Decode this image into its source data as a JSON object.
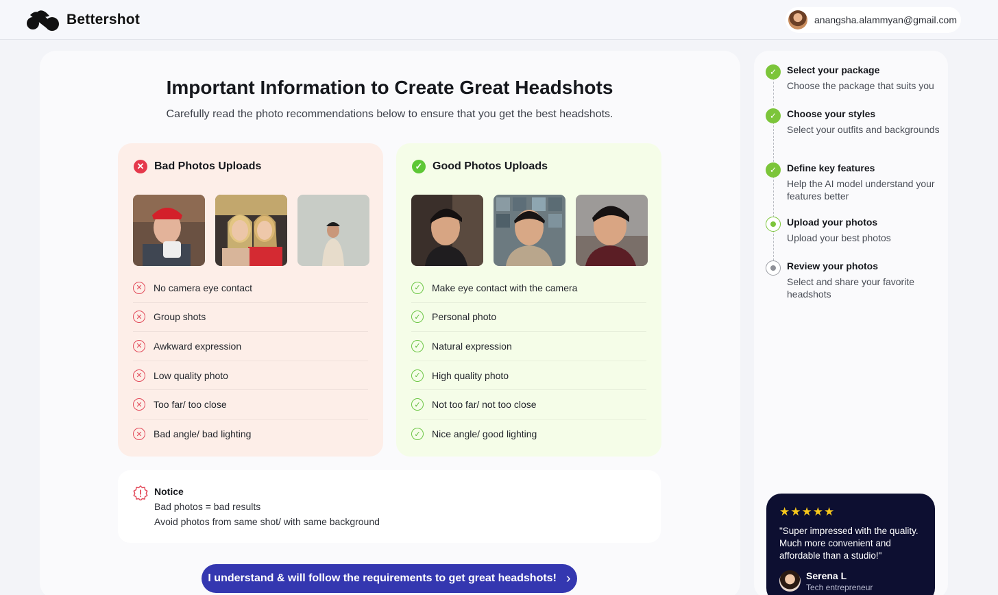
{
  "brand": {
    "name": "Bettershot"
  },
  "account": {
    "email": "anangsha.alammyan@gmail.com"
  },
  "page": {
    "title": "Important Information to Create Great Headshots",
    "subtitle": "Carefully read the photo recommendations below to ensure that you get the best headshots."
  },
  "bad_panel": {
    "title": "Bad Photos Uploads",
    "icon": "x-circle-icon",
    "accent": "#e5384b",
    "items": [
      "No camera eye contact",
      "Group shots",
      "Awkward expression",
      "Low quality photo",
      "Too far/ too close",
      "Bad angle/ bad lighting"
    ]
  },
  "good_panel": {
    "title": "Good Photos Uploads",
    "icon": "check-circle-icon",
    "accent": "#5dc735",
    "items": [
      "Make eye contact with the camera",
      "Personal photo",
      "Natural expression",
      "High quality photo",
      "Not too far/ not too close",
      "Nice angle/ good lighting"
    ]
  },
  "notice": {
    "title": "Notice",
    "lines": [
      "Bad photos = bad results",
      "Avoid photos from same shot/ with same background"
    ]
  },
  "cta": {
    "label": "I understand & will follow the requirements to get great headshots!",
    "color": "#3437b0"
  },
  "steps": [
    {
      "title": "Select your package",
      "desc": "Choose the package that suits you",
      "status": "done"
    },
    {
      "title": "Choose your styles",
      "desc": "Select your outfits and backgrounds",
      "status": "done"
    },
    {
      "title": "Define key features",
      "desc": "Help the AI model understand your features better",
      "status": "done"
    },
    {
      "title": "Upload your photos",
      "desc": "Upload your best photos",
      "status": "current"
    },
    {
      "title": "Review your photos",
      "desc": "Select and share your favorite headshots",
      "status": "todo"
    }
  ],
  "testimonial": {
    "stars": "★★★★★",
    "rating": 5,
    "quote": "\"Super impressed with the quality. Much more convenient and affordable than a studio!\"",
    "name": "Serena L",
    "role": "Tech entrepreneur"
  }
}
